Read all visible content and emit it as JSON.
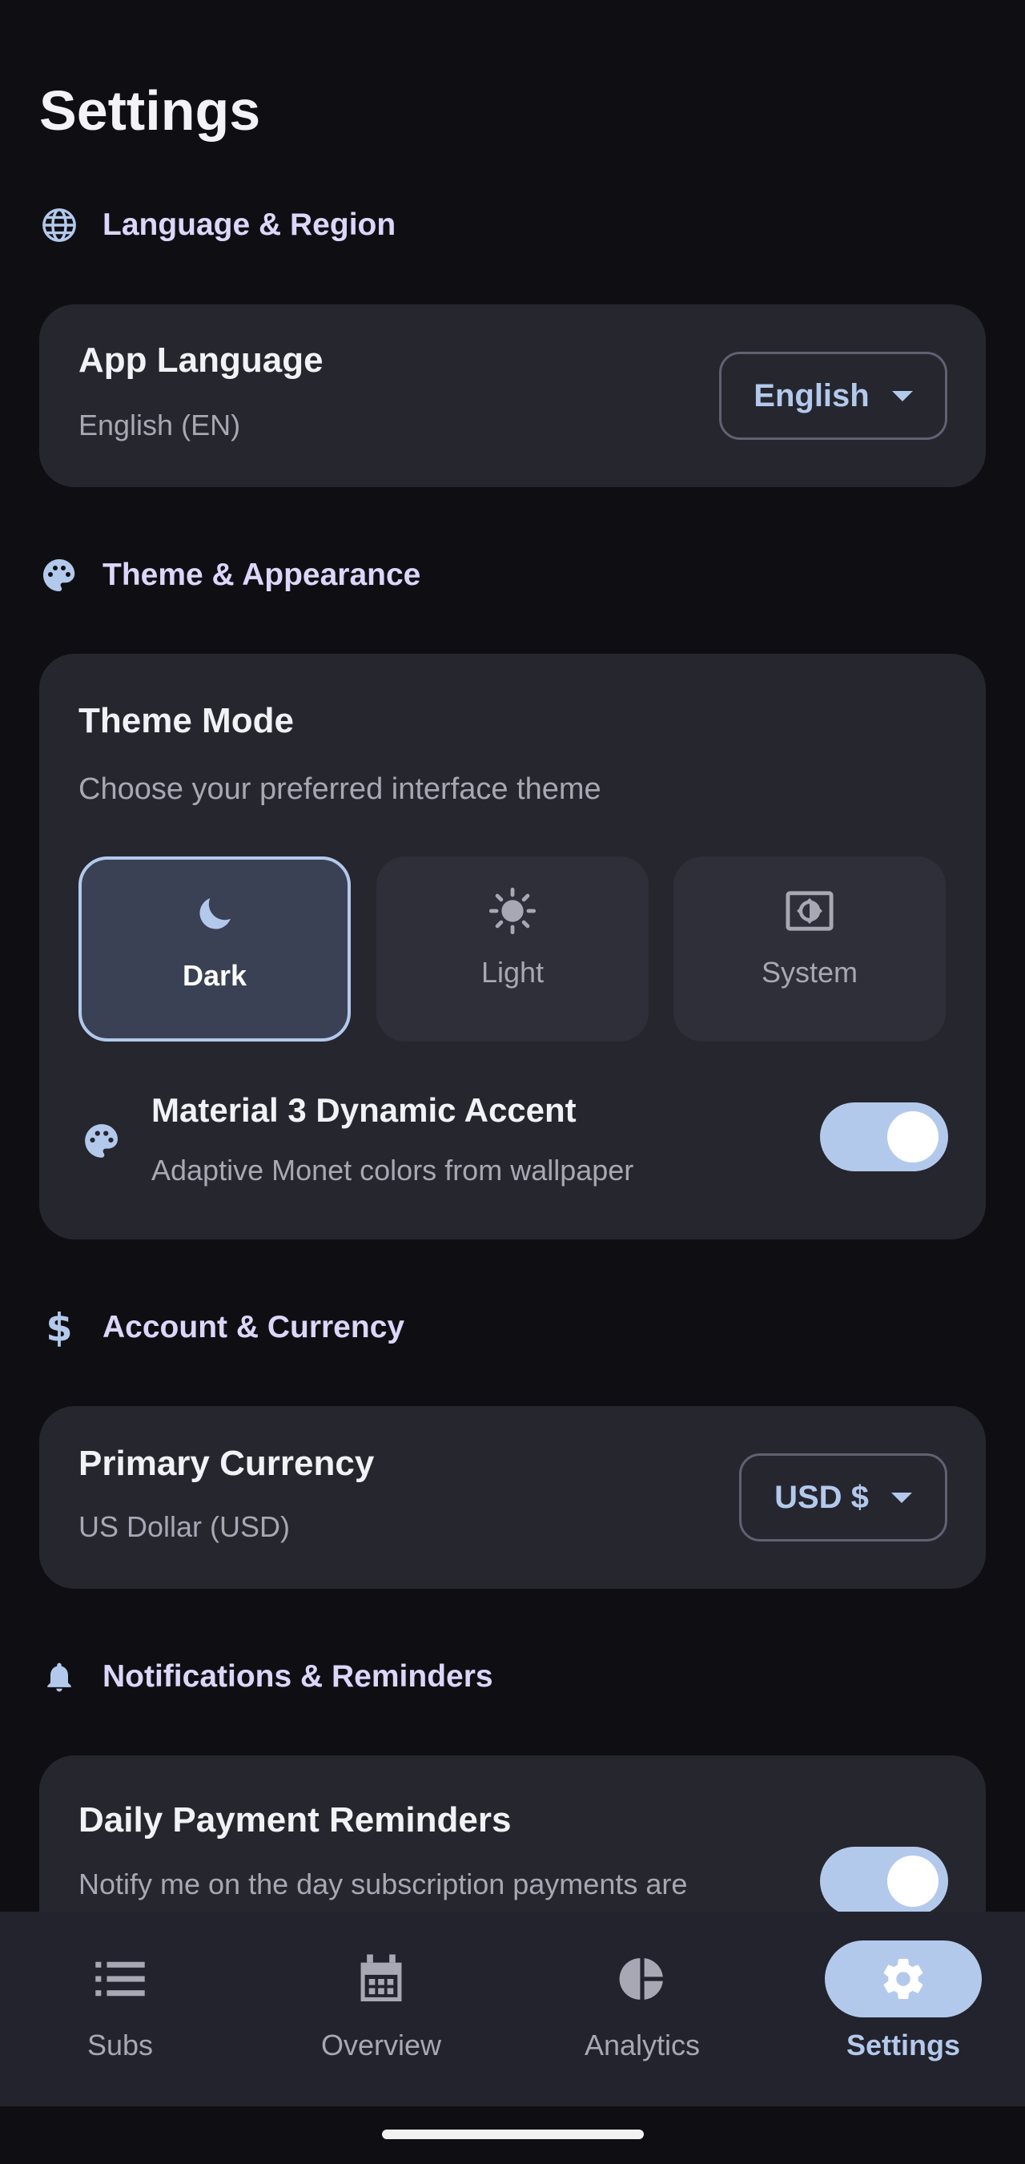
{
  "page": {
    "title": "Settings"
  },
  "sections": {
    "language": {
      "label": "Language & Region",
      "icon": "globe-icon"
    },
    "theme": {
      "label": "Theme & Appearance",
      "icon": "palette-icon"
    },
    "account": {
      "label": "Account & Currency",
      "icon": "dollar-icon"
    },
    "notifications": {
      "label": "Notifications & Reminders",
      "icon": "bell-icon"
    }
  },
  "app_language": {
    "title": "App Language",
    "subtitle": "English (EN)",
    "dropdown_value": "English"
  },
  "theme_mode": {
    "title": "Theme Mode",
    "subtitle": "Choose your preferred interface theme",
    "options": [
      {
        "label": "Dark",
        "icon": "moon-icon",
        "selected": true
      },
      {
        "label": "Light",
        "icon": "sun-icon",
        "selected": false
      },
      {
        "label": "System",
        "icon": "brightness-auto-icon",
        "selected": false
      }
    ],
    "dynamic_accent": {
      "title": "Material 3 Dynamic Accent",
      "subtitle": "Adaptive Monet colors from wallpaper",
      "enabled": true
    }
  },
  "currency": {
    "title": "Primary Currency",
    "subtitle": "US Dollar (USD)",
    "dropdown_value": "USD $"
  },
  "reminders": {
    "title": "Daily Payment Reminders",
    "subtitle": "Notify me on the day subscription payments are",
    "enabled": true
  },
  "bottom_nav": [
    {
      "label": "Subs",
      "icon": "list-icon",
      "active": false
    },
    {
      "label": "Overview",
      "icon": "calendar-icon",
      "active": false
    },
    {
      "label": "Analytics",
      "icon": "pie-chart-icon",
      "active": false
    },
    {
      "label": "Settings",
      "icon": "gear-icon",
      "active": true
    }
  ],
  "colors": {
    "background": "#0f0f13",
    "card": "#26262f",
    "accent": "#b3c9ec",
    "section_label": "#dcd6fa",
    "nav_background": "#22232c"
  }
}
